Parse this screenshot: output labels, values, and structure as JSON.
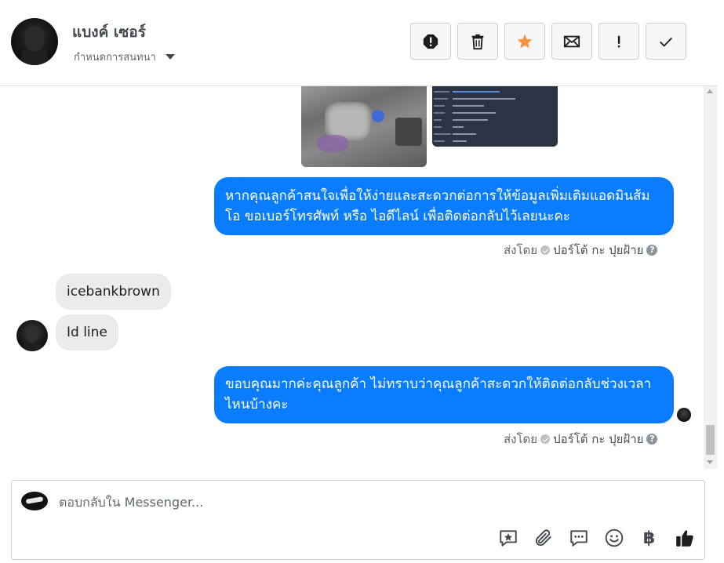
{
  "header": {
    "contact_name": "แบงค์ เซอร์",
    "label_action": "กำหนดการสนทนา",
    "actions": [
      {
        "name": "report-button",
        "icon": "exclamation-octagon-icon"
      },
      {
        "name": "delete-button",
        "icon": "trash-icon"
      },
      {
        "name": "star-button",
        "icon": "star-icon",
        "color": "#f7923b"
      },
      {
        "name": "mark-unread-button",
        "icon": "envelope-icon"
      },
      {
        "name": "follow-up-button",
        "icon": "exclamation-icon"
      },
      {
        "name": "mark-done-button",
        "icon": "checkmark-icon"
      }
    ]
  },
  "thread": {
    "messages": [
      {
        "direction": "outgoing",
        "text": "หากคุณลูกค้าสนใจเพื่อให้ง่ายและสะดวกต่อการให้ข้อมูลเพิ่มเติมแอดมินส้มโอ ขอเบอร์โทรศัพท์ หรือ ไอดีไลน์ เพื่อติดต่อกลับไว้เลยนะคะ",
        "sent_by": "ส่งโดย",
        "sender": "ปอร์โต้ กะ ปุยฝ้าย"
      },
      {
        "direction": "incoming",
        "text": "icebankbrown"
      },
      {
        "direction": "incoming",
        "text": "Id line"
      },
      {
        "direction": "outgoing",
        "text": "ขอบคุณมากค่ะคุณลูกค้า ไม่ทราบว่าคุณลูกค้าสะดวกให้ติดต่อกลับช่วงเวลาไหนบ้างคะ",
        "sent_by": "ส่งโดย",
        "sender": "ปอร์โต้ กะ ปุยฝ้าย"
      }
    ]
  },
  "composer": {
    "placeholder": "ตอบกลับใน Messenger...",
    "tools": [
      "saved-reply-icon",
      "attachment-icon",
      "chat-bubbles-icon",
      "emoji-icon",
      "baht-icon",
      "thumbs-up-icon"
    ],
    "baht_symbol": "฿"
  },
  "colors": {
    "outgoing_bubble": "#0a7cff",
    "incoming_bubble": "#ebebeb",
    "star": "#f7923b"
  }
}
